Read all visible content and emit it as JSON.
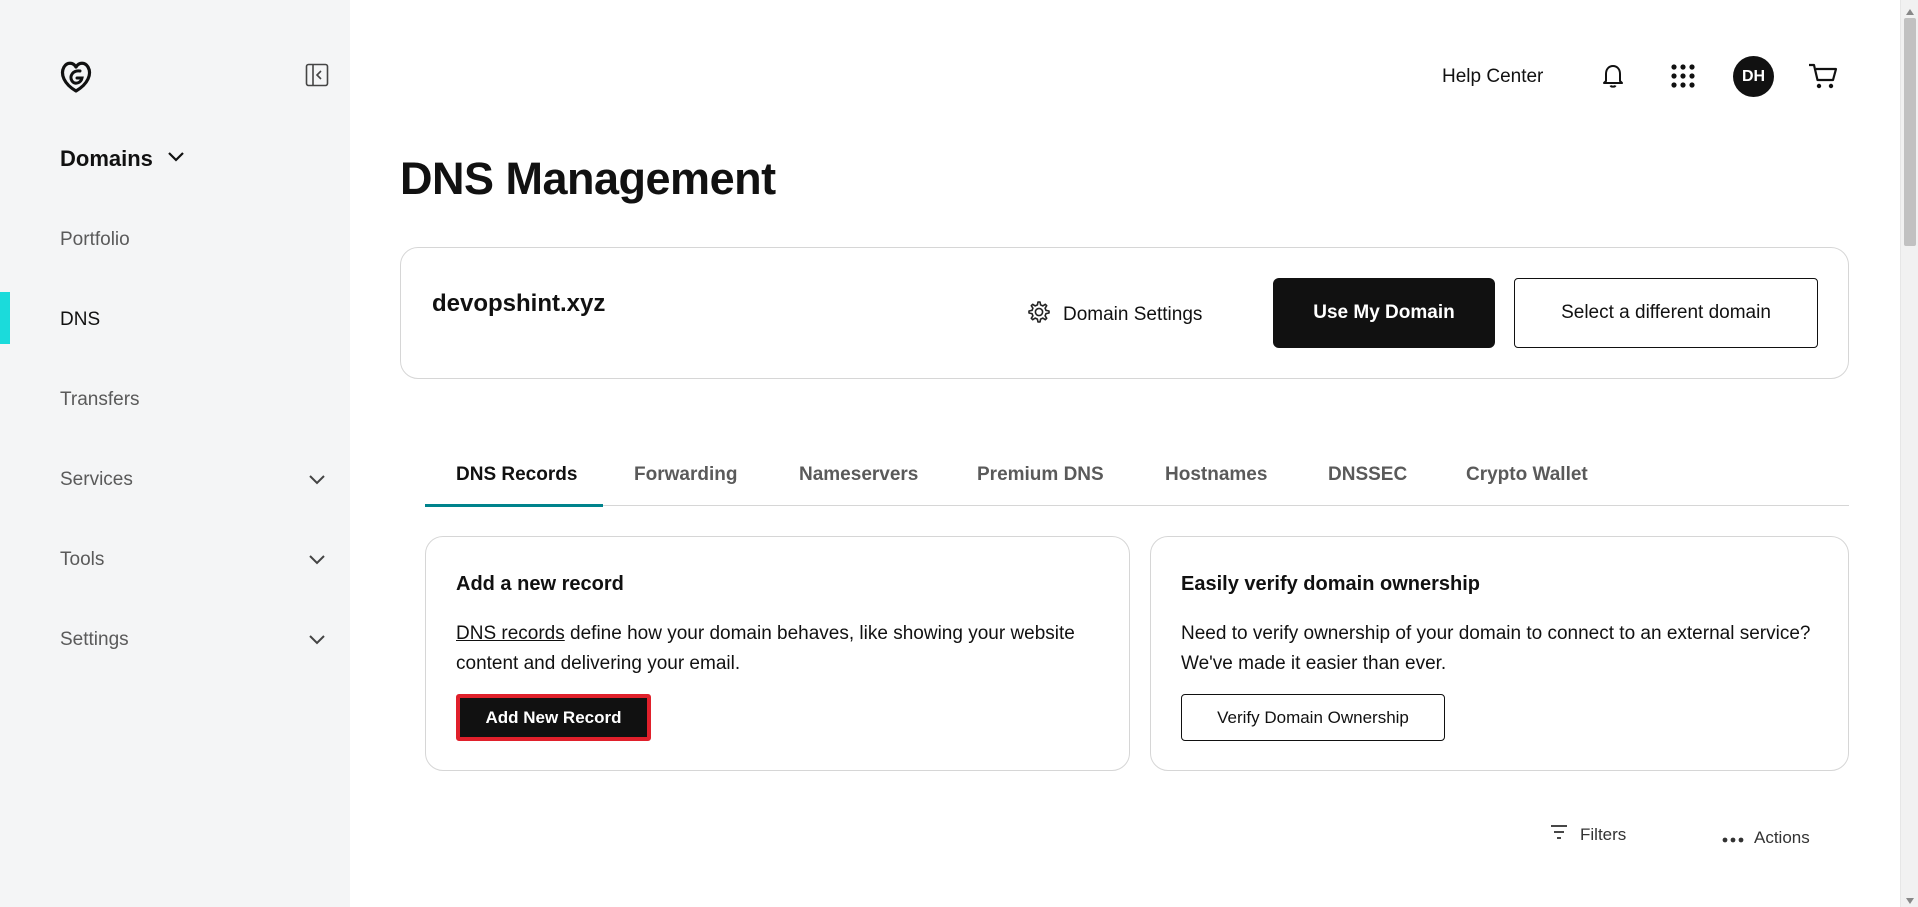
{
  "sidebar": {
    "section_title": "Domains",
    "items": [
      {
        "label": "Portfolio",
        "has_chevron": false
      },
      {
        "label": "DNS",
        "has_chevron": false,
        "active": true
      },
      {
        "label": "Transfers",
        "has_chevron": false
      },
      {
        "label": "Services",
        "has_chevron": true
      },
      {
        "label": "Tools",
        "has_chevron": true
      },
      {
        "label": "Settings",
        "has_chevron": true
      }
    ]
  },
  "topbar": {
    "help_label": "Help Center",
    "avatar_initials": "DH"
  },
  "page": {
    "title": "DNS Management"
  },
  "domain_card": {
    "domain_name": "devopshint.xyz",
    "settings_label": "Domain Settings",
    "use_domain_label": "Use My Domain",
    "select_domain_label": "Select a different domain"
  },
  "tabs": [
    {
      "label": "DNS Records",
      "active": true
    },
    {
      "label": "Forwarding"
    },
    {
      "label": "Nameservers"
    },
    {
      "label": "Premium DNS"
    },
    {
      "label": "Hostnames"
    },
    {
      "label": "DNSSEC"
    },
    {
      "label": "Crypto Wallet"
    }
  ],
  "add_record_card": {
    "title": "Add a new record",
    "link_text": "DNS records",
    "body_text": " define how your domain behaves, like showing your website content and delivering your email.",
    "button_label": "Add New Record"
  },
  "verify_card": {
    "title": "Easily verify domain ownership",
    "body_text": "Need to verify ownership of your domain to connect to an external service? We've made it easier than ever.",
    "button_label": "Verify Domain Ownership"
  },
  "toolbar": {
    "filters_label": "Filters",
    "actions_label": "Actions"
  },
  "colors": {
    "active_indicator": "#1bdbdb",
    "tab_underline": "#00838c",
    "highlight_border": "#e0202b",
    "primary_button": "#111111"
  }
}
